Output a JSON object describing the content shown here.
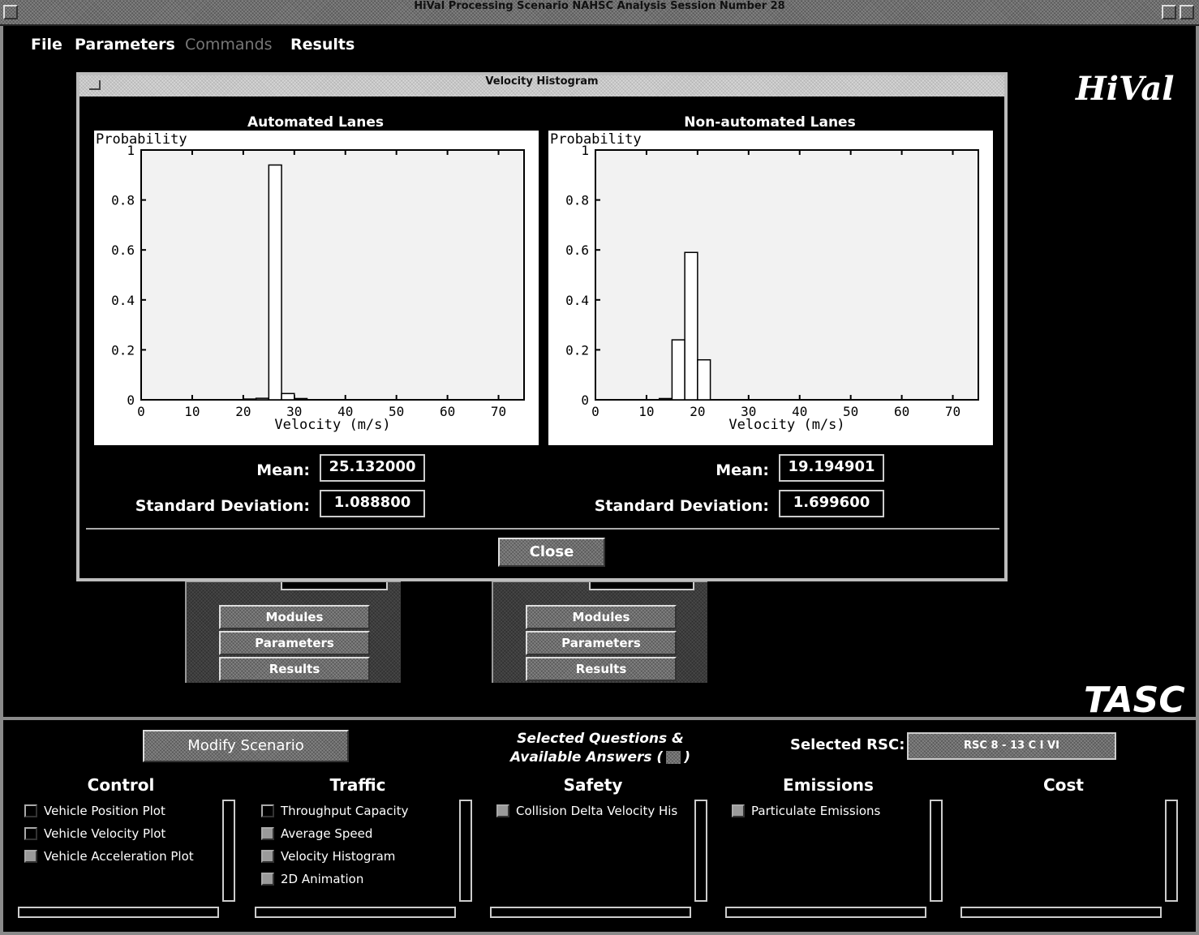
{
  "window": {
    "title": "HiVal Processing Scenario NAHSC Analysis Session Number 28"
  },
  "menu": {
    "items": [
      {
        "label": "File",
        "disabled": false
      },
      {
        "label": "Parameters",
        "disabled": false
      },
      {
        "label": "Commands",
        "disabled": true
      },
      {
        "label": "Results",
        "disabled": false
      }
    ]
  },
  "brand": {
    "top": "HiVal",
    "bottom": "TASC"
  },
  "dialog": {
    "title": "Velocity Histogram",
    "close_label": "Close",
    "left": {
      "heading": "Automated Lanes",
      "mean_label": "Mean:",
      "mean": "25.132000",
      "sd_label": "Standard Deviation:",
      "sd": "1.088800"
    },
    "right": {
      "heading": "Non-automated Lanes",
      "mean_label": "Mean:",
      "mean": "19.194901",
      "sd_label": "Standard Deviation:",
      "sd": "1.699600"
    }
  },
  "chart_data": [
    {
      "type": "bar",
      "title": "Automated Lanes",
      "xlabel": "Velocity (m/s)",
      "ylabel": "Probability",
      "xlim": [
        0,
        75
      ],
      "ylim": [
        0,
        1
      ],
      "xticks": [
        0,
        10,
        20,
        30,
        40,
        50,
        60,
        70
      ],
      "yticks": [
        0,
        0.2,
        0.4,
        0.6,
        0.8,
        1
      ],
      "bin_width": 2.5,
      "bins": [
        {
          "x": 20,
          "y": 0.003
        },
        {
          "x": 22.5,
          "y": 0.006
        },
        {
          "x": 25,
          "y": 0.94
        },
        {
          "x": 27.5,
          "y": 0.025
        },
        {
          "x": 30,
          "y": 0.005
        }
      ]
    },
    {
      "type": "bar",
      "title": "Non-automated Lanes",
      "xlabel": "Velocity (m/s)",
      "ylabel": "Probability",
      "xlim": [
        0,
        75
      ],
      "ylim": [
        0,
        1
      ],
      "xticks": [
        0,
        10,
        20,
        30,
        40,
        50,
        60,
        70
      ],
      "yticks": [
        0,
        0.2,
        0.4,
        0.6,
        0.8,
        1
      ],
      "bin_width": 2.5,
      "bins": [
        {
          "x": 12.5,
          "y": 0.005
        },
        {
          "x": 15,
          "y": 0.24
        },
        {
          "x": 17.5,
          "y": 0.59
        },
        {
          "x": 20,
          "y": 0.16
        }
      ]
    }
  ],
  "background_panels": {
    "left": {
      "buttons": [
        "Modules",
        "Parameters",
        "Results"
      ]
    },
    "right": {
      "buttons": [
        "Modules",
        "Parameters",
        "Results"
      ]
    }
  },
  "bottom": {
    "modify_label": "Modify Scenario",
    "selected_q_label": "Selected Questions &",
    "selected_q_label2": "Available Answers (",
    "selected_q_label3": ")",
    "rsc_label": "Selected RSC:",
    "rsc_value": "RSC 8 - 13 C I VI",
    "categories": [
      {
        "name": "Control",
        "items": [
          {
            "label": "Vehicle Position Plot",
            "checked": false
          },
          {
            "label": "Vehicle Velocity Plot",
            "checked": false
          },
          {
            "label": "Vehicle Acceleration Plot",
            "checked": true
          }
        ]
      },
      {
        "name": "Traffic",
        "items": [
          {
            "label": "Throughput Capacity",
            "checked": false
          },
          {
            "label": "Average Speed",
            "checked": true
          },
          {
            "label": "Velocity Histogram",
            "checked": true
          },
          {
            "label": "2D Animation",
            "checked": true
          }
        ]
      },
      {
        "name": "Safety",
        "items": [
          {
            "label": "Collision Delta Velocity His",
            "checked": true
          }
        ]
      },
      {
        "name": "Emissions",
        "items": [
          {
            "label": "Particulate Emissions",
            "checked": true
          }
        ]
      },
      {
        "name": "Cost",
        "items": []
      }
    ]
  }
}
